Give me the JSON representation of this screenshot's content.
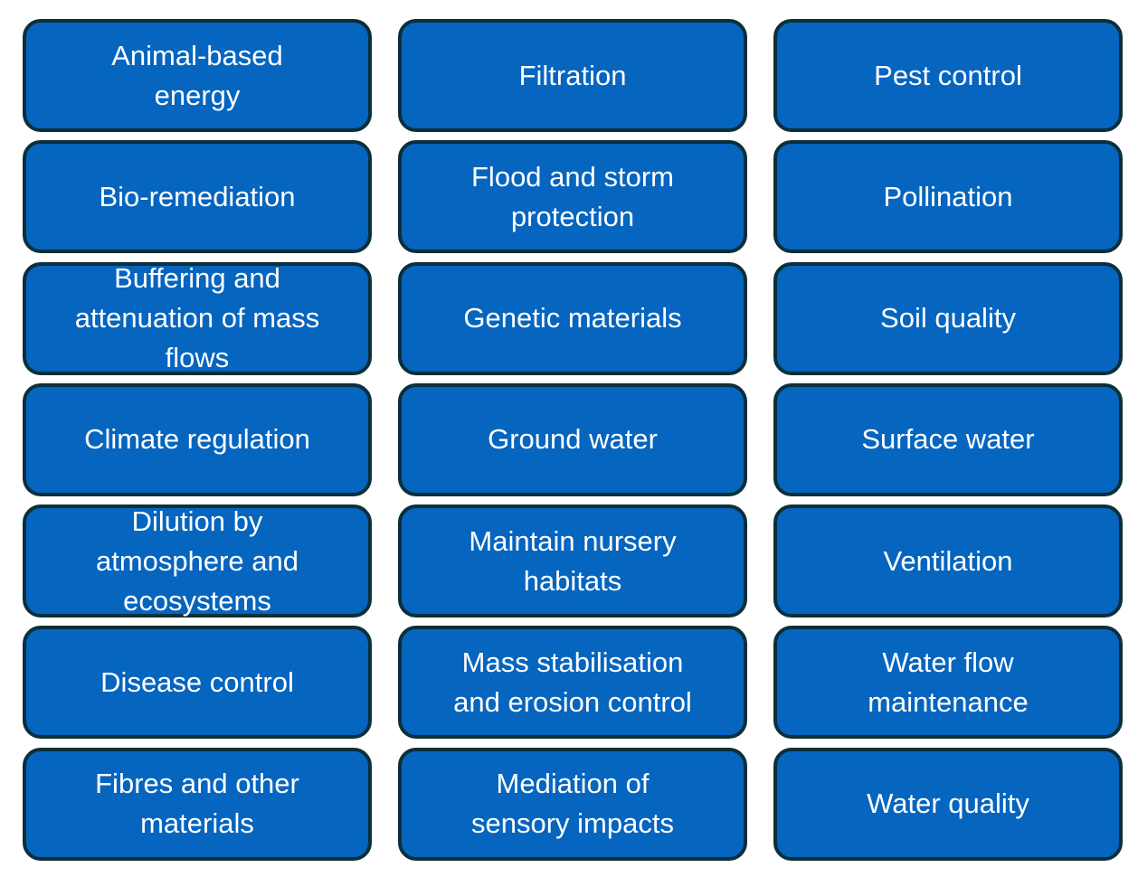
{
  "colors": {
    "box_fill": "#0565bf",
    "box_border": "#0b2f3b",
    "text": "#ffffff",
    "background": "#ffffff"
  },
  "columns": [
    {
      "items": [
        {
          "label": "Animal-based energy",
          "lines": [
            "Animal-based",
            "energy"
          ]
        },
        {
          "label": "Bio-remediation",
          "lines": [
            "Bio-remediation"
          ]
        },
        {
          "label": "Buffering and attenuation of mass flows",
          "lines": [
            "Buffering and",
            "attenuation of mass",
            "flows"
          ]
        },
        {
          "label": "Climate regulation",
          "lines": [
            "Climate regulation"
          ]
        },
        {
          "label": "Dilution by atmosphere and ecosystems",
          "lines": [
            "Dilution by",
            "atmosphere and",
            "ecosystems"
          ]
        },
        {
          "label": "Disease control",
          "lines": [
            "Disease control"
          ]
        },
        {
          "label": "Fibres and other materials",
          "lines": [
            "Fibres and other",
            "materials"
          ]
        }
      ]
    },
    {
      "items": [
        {
          "label": "Filtration",
          "lines": [
            "Filtration"
          ]
        },
        {
          "label": "Flood and storm protection",
          "lines": [
            "Flood and storm",
            "protection"
          ]
        },
        {
          "label": "Genetic materials",
          "lines": [
            "Genetic materials"
          ]
        },
        {
          "label": "Ground water",
          "lines": [
            "Ground water"
          ]
        },
        {
          "label": "Maintain nursery habitats",
          "lines": [
            "Maintain nursery",
            "habitats"
          ]
        },
        {
          "label": "Mass stabilisation and erosion control",
          "lines": [
            "Mass stabilisation",
            "and erosion control"
          ]
        },
        {
          "label": "Mediation of sensory impacts",
          "lines": [
            "Mediation of",
            "sensory impacts"
          ]
        }
      ]
    },
    {
      "items": [
        {
          "label": "Pest control",
          "lines": [
            "Pest control"
          ]
        },
        {
          "label": "Pollination",
          "lines": [
            "Pollination"
          ]
        },
        {
          "label": "Soil quality",
          "lines": [
            "Soil quality"
          ]
        },
        {
          "label": "Surface water",
          "lines": [
            "Surface water"
          ]
        },
        {
          "label": "Ventilation",
          "lines": [
            "Ventilation"
          ]
        },
        {
          "label": "Water flow maintenance",
          "lines": [
            "Water flow",
            "maintenance"
          ]
        },
        {
          "label": "Water quality",
          "lines": [
            "Water quality"
          ]
        }
      ]
    }
  ]
}
